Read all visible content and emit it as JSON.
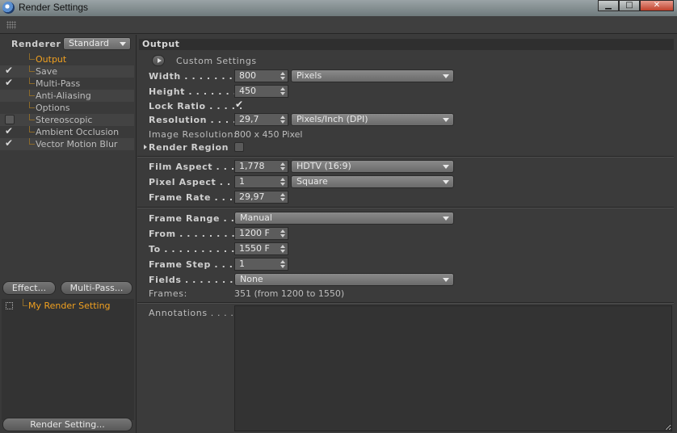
{
  "window": {
    "title": "Render Settings",
    "minimize": "▁",
    "maximize": "□",
    "close": "✕"
  },
  "left": {
    "renderer_label": "Renderer",
    "renderer_value": "Standard",
    "tree": [
      {
        "label": "Output",
        "check": "none",
        "active": true
      },
      {
        "label": "Save",
        "check": "on"
      },
      {
        "label": "Multi-Pass",
        "check": "on"
      },
      {
        "label": "Anti-Aliasing",
        "check": "none"
      },
      {
        "label": "Options",
        "check": "none"
      },
      {
        "label": "Stereoscopic",
        "check": "off"
      },
      {
        "label": "Ambient Occlusion",
        "check": "on"
      },
      {
        "label": "Vector Motion Blur",
        "check": "on"
      }
    ],
    "effect_button": "Effect...",
    "multipass_button": "Multi-Pass...",
    "settings": [
      {
        "label": "My Render Setting"
      }
    ],
    "render_setting_button": "Render Setting..."
  },
  "output": {
    "header": "Output",
    "custom_settings": "Custom Settings",
    "width_label": "Width . . . . . . . . . .",
    "width_value": "800",
    "width_unit": "Pixels",
    "height_label": "Height . . . . . . . . . .",
    "height_value": "450",
    "lock_ratio_label": "Lock Ratio . . . . .",
    "lock_ratio_checked": true,
    "resolution_label": "Resolution . . . . .",
    "resolution_value": "29,7",
    "resolution_unit": "Pixels/Inch (DPI)",
    "image_resolution_label": "Image Resolution:",
    "image_resolution_value": "800 x 450 Pixel",
    "render_region_label": "Render Region",
    "render_region_checked": false,
    "film_aspect_label": "Film Aspect . . . .",
    "film_aspect_value": "1,778",
    "film_aspect_preset": "HDTV (16:9)",
    "pixel_aspect_label": "Pixel Aspect . . .",
    "pixel_aspect_value": "1",
    "pixel_aspect_preset": "Square",
    "frame_rate_label": "Frame Rate . . . .",
    "frame_rate_value": "29,97",
    "frame_range_label": "Frame Range . .",
    "frame_range_value": "Manual",
    "from_label": "From . . . . . . . . . . .",
    "from_value": "1200 F",
    "to_label": "To . . . . . . . . . . . . .",
    "to_value": "1550 F",
    "frame_step_label": "Frame Step . . . .",
    "frame_step_value": "1",
    "fields_label": "Fields . . . . . . . . . .",
    "fields_value": "None",
    "frames_label": "Frames:",
    "frames_value": "351 (from 1200 to 1550)",
    "annotations_label": "Annotations . . . . ."
  },
  "colors": {
    "accent": "#f0a020",
    "panel": "#3b3b3b",
    "field": "#5c5c5c",
    "dropdown": "#7a7a7a"
  },
  "icons": {
    "app": "cinema4d-logo-icon",
    "grip": "grip-dots-icon",
    "check": "checkmark-icon"
  }
}
